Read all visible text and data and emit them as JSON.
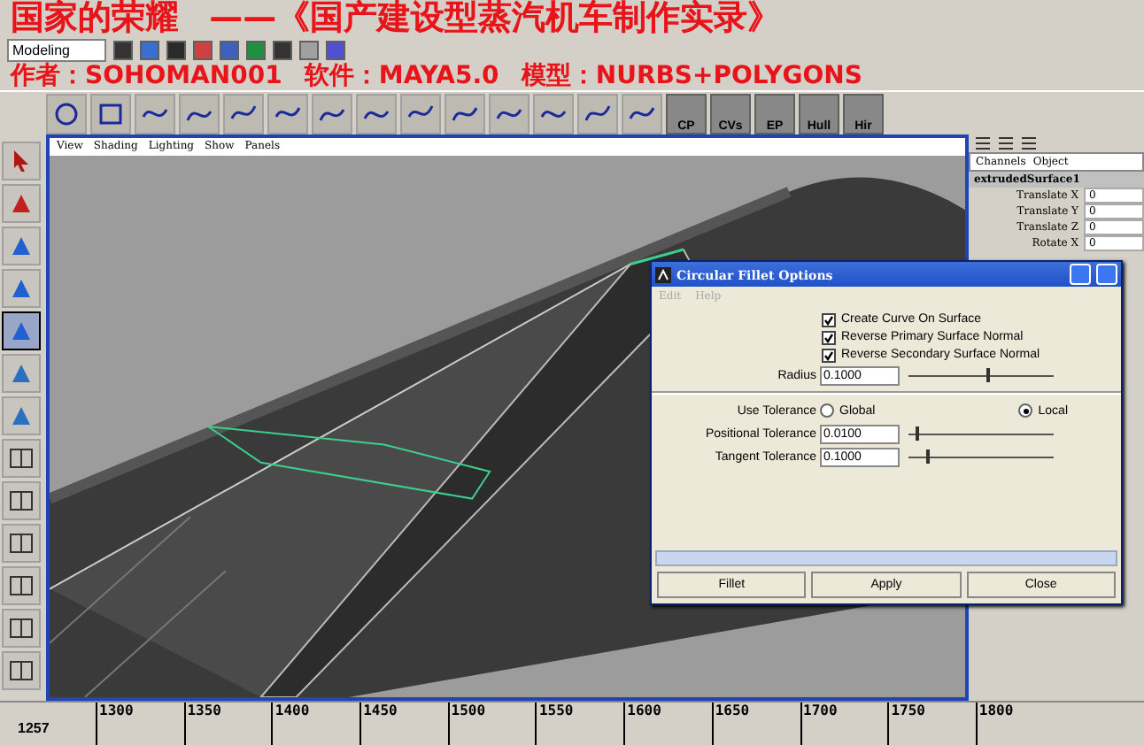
{
  "title_overlay": {
    "line_1": [
      "国家的荣耀",
      "——《国产建设型蒸汽机车制作实录》"
    ],
    "line_2": [
      "作者：SOHOMAN001",
      "软件：MAYA5.0",
      "模型：NURBS+POLYGONS"
    ]
  },
  "status_line": {
    "menu_set": "Modeling"
  },
  "shelf": {
    "labeled_tools": [
      "CP",
      "CVs",
      "EP",
      "Hull",
      "Hir"
    ]
  },
  "viewport": {
    "menu": [
      "View",
      "Shading",
      "Lighting",
      "Show",
      "Panels"
    ]
  },
  "channel_box": {
    "menu": [
      "Channels",
      "Object"
    ],
    "node": "extrudedSurface1",
    "attributes": [
      {
        "name": "Translate X",
        "value": "0"
      },
      {
        "name": "Translate Y",
        "value": "0"
      },
      {
        "name": "Translate Z",
        "value": "0"
      },
      {
        "name": "Rotate X",
        "value": "0"
      }
    ]
  },
  "dialog": {
    "title": "Circular Fillet Options",
    "menu": [
      "Edit",
      "Help"
    ],
    "checkboxes": [
      {
        "label": "Create Curve On Surface",
        "checked": true
      },
      {
        "label": "Reverse Primary Surface Normal",
        "checked": true
      },
      {
        "label": "Reverse Secondary Surface Normal",
        "checked": true
      }
    ],
    "radius": {
      "label": "Radius",
      "value": "0.1000",
      "level": 0.55
    },
    "use_tolerance": {
      "label": "Use Tolerance",
      "options": [
        {
          "label": "Global",
          "selected": false
        },
        {
          "label": "Local",
          "selected": true
        }
      ]
    },
    "tolerances": [
      {
        "label": "Positional Tolerance",
        "value": "0.0100",
        "level": 0.05
      },
      {
        "label": "Tangent Tolerance",
        "value": "0.1000",
        "level": 0.13
      }
    ],
    "buttons": [
      "Fillet",
      "Apply",
      "Close"
    ]
  },
  "timeline": {
    "start_frame": "1257",
    "ticks": [
      "1300",
      "1350",
      "1400",
      "1450",
      "1500",
      "1550",
      "1600",
      "1650",
      "1700",
      "1750",
      "1800"
    ]
  }
}
